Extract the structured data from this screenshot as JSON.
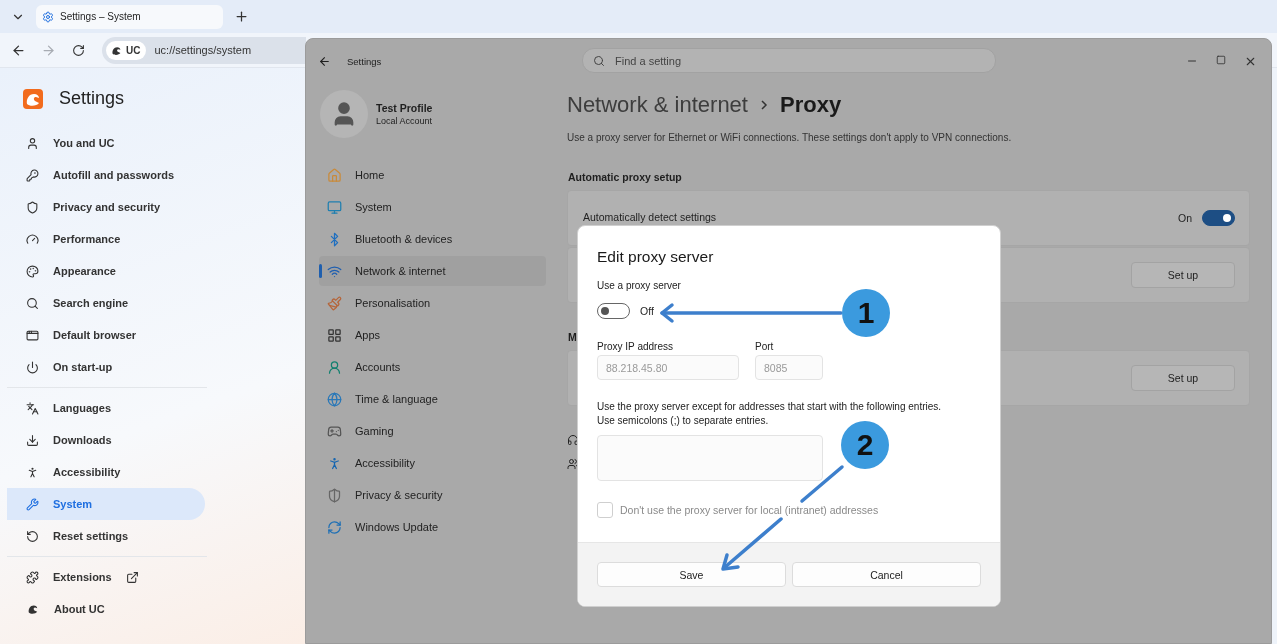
{
  "browser": {
    "tab": {
      "title": "Settings – System",
      "selected": true
    },
    "forward_button": {
      "disabled": true
    },
    "address_bar": {
      "badge": "UC",
      "url": "uc://settings/system"
    },
    "sidebar": {
      "title": "Settings",
      "sections": [
        {
          "items": [
            {
              "label": "You and UC",
              "selected": false,
              "external": false
            },
            {
              "label": "Autofill and passwords",
              "selected": false,
              "external": false
            },
            {
              "label": "Privacy and security",
              "selected": false,
              "external": false
            },
            {
              "label": "Performance",
              "selected": false,
              "external": false
            },
            {
              "label": "Appearance",
              "selected": false,
              "external": false
            },
            {
              "label": "Search engine",
              "selected": false,
              "external": false
            },
            {
              "label": "Default browser",
              "selected": false,
              "external": false
            },
            {
              "label": "On start-up",
              "selected": false,
              "external": false
            }
          ]
        },
        {
          "items": [
            {
              "label": "Languages",
              "selected": false,
              "external": false
            },
            {
              "label": "Downloads",
              "selected": false,
              "external": false
            },
            {
              "label": "Accessibility",
              "selected": false,
              "external": false
            },
            {
              "label": "System",
              "selected": true,
              "external": false
            },
            {
              "label": "Reset settings",
              "selected": false,
              "external": false
            }
          ]
        },
        {
          "items": [
            {
              "label": "Extensions",
              "selected": false,
              "external": true
            },
            {
              "label": "About UC",
              "selected": false,
              "external": false
            }
          ]
        }
      ]
    }
  },
  "settings_window": {
    "title": "Settings",
    "search": {
      "placeholder": "Find a setting"
    },
    "profile": {
      "name": "Test Profile",
      "account": "Local Account"
    },
    "nav": [
      {
        "label": "Home",
        "selected": false
      },
      {
        "label": "System",
        "selected": false
      },
      {
        "label": "Bluetooth & devices",
        "selected": false
      },
      {
        "label": "Network & internet",
        "selected": true
      },
      {
        "label": "Personalisation",
        "selected": false
      },
      {
        "label": "Apps",
        "selected": false
      },
      {
        "label": "Accounts",
        "selected": false
      },
      {
        "label": "Time & language",
        "selected": false
      },
      {
        "label": "Gaming",
        "selected": false
      },
      {
        "label": "Accessibility",
        "selected": false
      },
      {
        "label": "Privacy & security",
        "selected": false
      },
      {
        "label": "Windows Update",
        "selected": false
      }
    ],
    "breadcrumb": {
      "parent": "Network & internet",
      "current": "Proxy"
    },
    "description": "Use a proxy server for Ethernet or WiFi connections. These settings don't apply to VPN connections.",
    "sections": [
      {
        "heading": "Automatic proxy setup",
        "rows": [
          {
            "kind": "toggle",
            "label": "Automatically detect settings",
            "state_label": "On",
            "on": true
          },
          {
            "kind": "button",
            "button": "Set up"
          }
        ]
      },
      {
        "heading": "M",
        "rows": [
          {
            "kind": "button",
            "button": "Set up"
          }
        ]
      }
    ]
  },
  "dialog": {
    "title": "Edit proxy server",
    "use_proxy": {
      "label": "Use a proxy server",
      "on": false,
      "state_label": "Off"
    },
    "ip": {
      "label": "Proxy IP address",
      "value": "88.218.45.80",
      "disabled": true
    },
    "port": {
      "label": "Port",
      "value": "8085",
      "disabled": true
    },
    "exceptions": {
      "hint_lines": [
        "Use the proxy server except for addresses that start with the following entries.",
        "Use semicolons (;) to separate entries."
      ]
    },
    "bypass_local": {
      "label": "Don't use the proxy server for local (intranet) addresses",
      "checked": false,
      "disabled": true
    },
    "buttons": [
      "Save",
      "Cancel"
    ]
  },
  "annotations": [
    {
      "number": "1"
    },
    {
      "number": "2"
    }
  ]
}
